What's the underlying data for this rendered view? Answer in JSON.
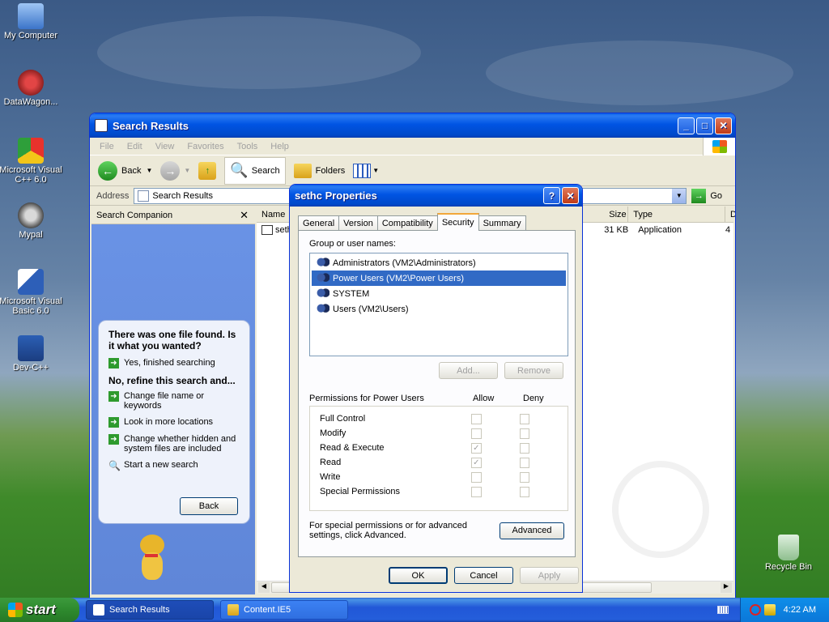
{
  "desktop": {
    "icons": [
      {
        "label": "My Computer"
      },
      {
        "label": "DataWagon..."
      },
      {
        "label": "Microsoft Visual C++ 6.0"
      },
      {
        "label": "Mypal"
      },
      {
        "label": "Microsoft Visual Basic 6.0"
      },
      {
        "label": "Dev-C++"
      },
      {
        "label": "Recycle Bin"
      }
    ]
  },
  "explorer": {
    "title": "Search Results",
    "menu": [
      "File",
      "Edit",
      "View",
      "Favorites",
      "Tools",
      "Help"
    ],
    "toolbar": {
      "back": "Back",
      "search": "Search",
      "folders": "Folders"
    },
    "address": {
      "label": "Address",
      "value": "Search Results",
      "go": "Go"
    },
    "companion": {
      "title": "Search Companion",
      "question": "There was one file found.  Is it what you wanted?",
      "yes": "Yes, finished searching",
      "refine_heading": "No, refine this search and...",
      "options": [
        "Change file name or keywords",
        "Look in more locations",
        "Change whether hidden and system files are included"
      ],
      "new_search": "Start a new search",
      "back_button": "Back"
    },
    "list": {
      "columns": [
        "Name",
        "Size",
        "Type",
        "D"
      ],
      "row": {
        "name": "seth",
        "size": "31 KB",
        "type": "Application",
        "d": "4"
      }
    }
  },
  "dialog": {
    "title": "sethc Properties",
    "tabs": [
      "General",
      "Version",
      "Compatibility",
      "Security",
      "Summary"
    ],
    "active_tab": "Security",
    "group_label": "Group or user names:",
    "users": [
      "Administrators (VM2\\Administrators)",
      "Power Users (VM2\\Power Users)",
      "SYSTEM",
      "Users (VM2\\Users)"
    ],
    "selected_user": "Power Users (VM2\\Power Users)",
    "add_button": "Add...",
    "remove_button": "Remove",
    "permissions_label": "Permissions for Power Users",
    "allow_label": "Allow",
    "deny_label": "Deny",
    "permissions": [
      {
        "name": "Full Control",
        "allow": false,
        "deny": false
      },
      {
        "name": "Modify",
        "allow": false,
        "deny": false
      },
      {
        "name": "Read & Execute",
        "allow": true,
        "deny": false
      },
      {
        "name": "Read",
        "allow": true,
        "deny": false
      },
      {
        "name": "Write",
        "allow": false,
        "deny": false
      },
      {
        "name": "Special Permissions",
        "allow": false,
        "deny": false
      }
    ],
    "advanced_text": "For special permissions or for advanced settings, click Advanced.",
    "advanced_button": "Advanced",
    "ok": "OK",
    "cancel": "Cancel",
    "apply": "Apply"
  },
  "taskbar": {
    "start": "start",
    "tasks": [
      "Search Results",
      "Content.IE5"
    ],
    "clock": "4:22 AM"
  },
  "colors": {
    "titlebar": "#0054e3",
    "selection": "#316ac5",
    "start": "#2e8a2e"
  }
}
